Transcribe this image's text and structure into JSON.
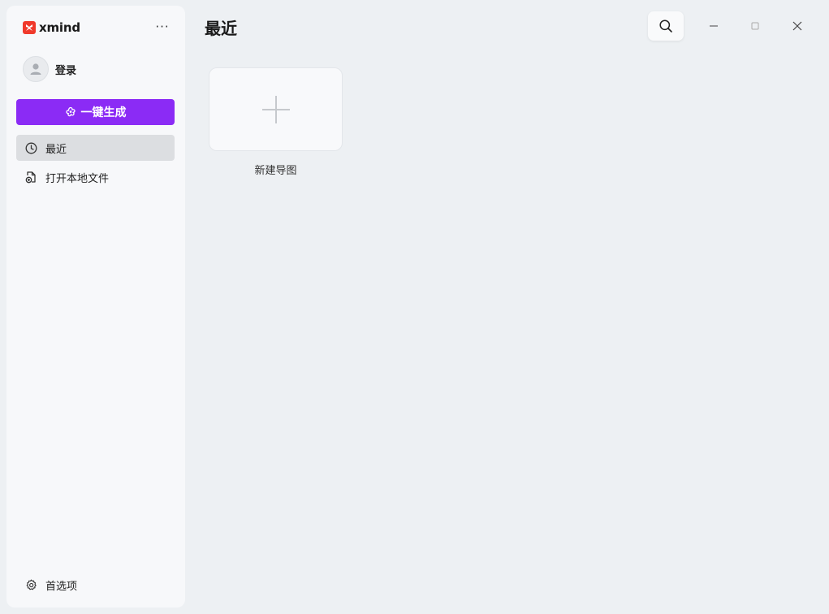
{
  "app": {
    "brand": "xmind"
  },
  "sidebar": {
    "more_label": "···",
    "login_label": "登录",
    "generate_label": "一键生成",
    "items": [
      {
        "label": "最近",
        "icon": "clock-icon",
        "active": true
      },
      {
        "label": "打开本地文件",
        "icon": "open-file-icon",
        "active": false
      }
    ],
    "preferences_label": "首选项"
  },
  "main": {
    "title": "最近",
    "new_map_label": "新建导图"
  },
  "colors": {
    "accent": "#8b2bf5",
    "brand_red": "#f0392b"
  }
}
